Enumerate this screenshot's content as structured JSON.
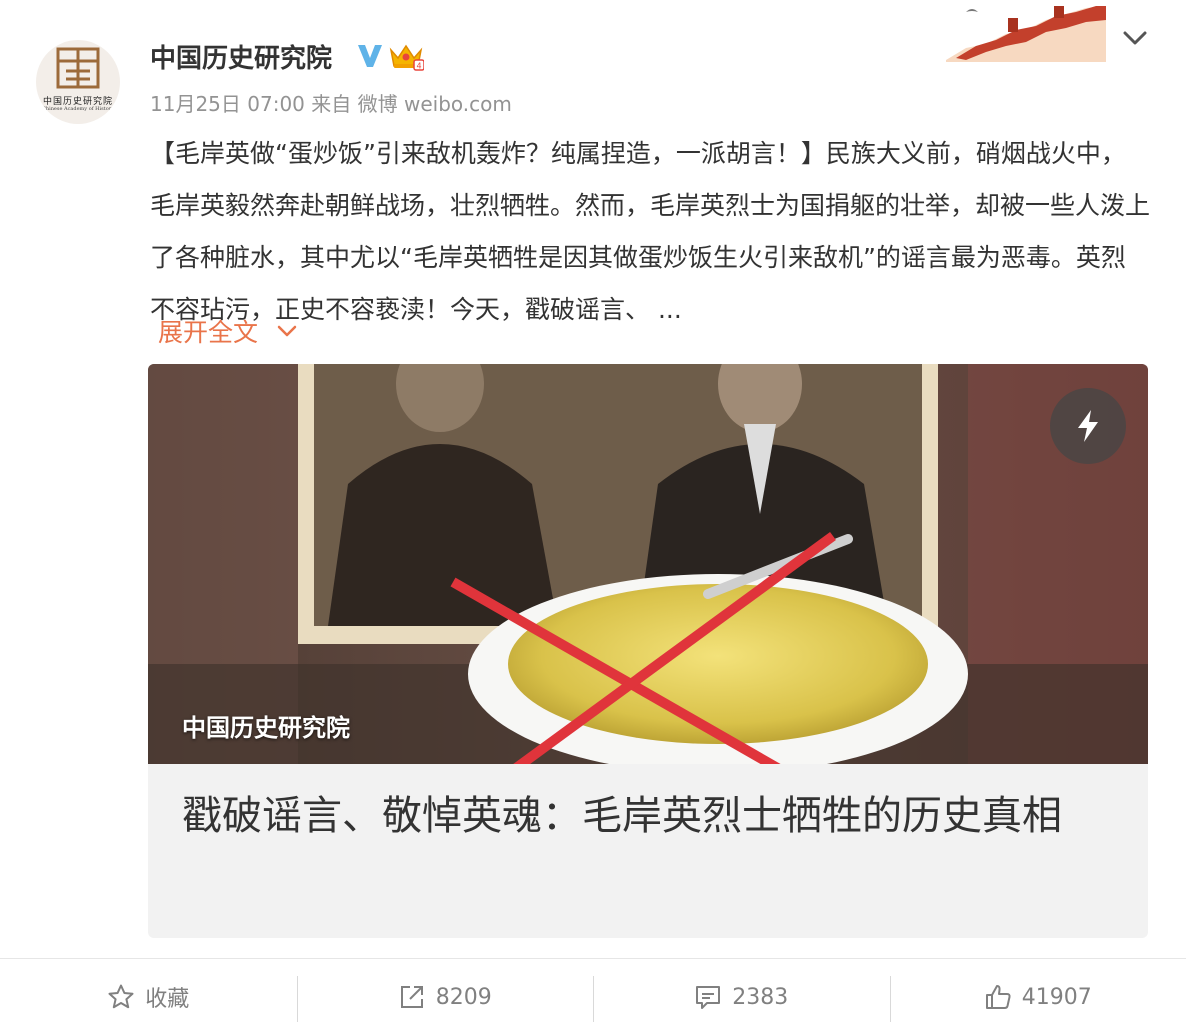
{
  "author": {
    "name": "中国历史研究院",
    "avatar_text": "中国历史研究院",
    "avatar_subtext": "Chinese Academy of History",
    "verified_icon": "verified-v-icon",
    "member_icon": "crown-icon"
  },
  "meta": {
    "date": "11月25日 07:00",
    "source": "来自 微博 weibo.com"
  },
  "post": {
    "text": "【毛岸英做“蛋炒饭”引来敌机轰炸？纯属捏造，一派胡言！】民族大义前，硝烟战火中，毛岸英毅然奔赴朝鲜战场，壮烈牺牲。然而，毛岸英烈士为国捐躯的壮举，却被一些人泼上了各种脏水，其中尤以“毛岸英牺牲是因其做蛋炒饭生火引来敌机”的谣言最为恶毒。英烈不容玷污，正史不容亵渎！今天，戳破谣言、 ...",
    "expand_label": "展开全文"
  },
  "card": {
    "watermark": "中国历史研究院",
    "title": "戳破谣言、敬悼英魂：毛岸英烈士牺牲的历史真相",
    "badge_icon": "lightning-icon"
  },
  "actions": {
    "favorite_label": "收藏",
    "repost_count": "8209",
    "comment_count": "2383",
    "like_count": "41907"
  },
  "colors": {
    "accent_link": "#e9744a",
    "text_primary": "#333333",
    "text_meta": "#939393",
    "verified_blue": "#5fb3e8"
  }
}
